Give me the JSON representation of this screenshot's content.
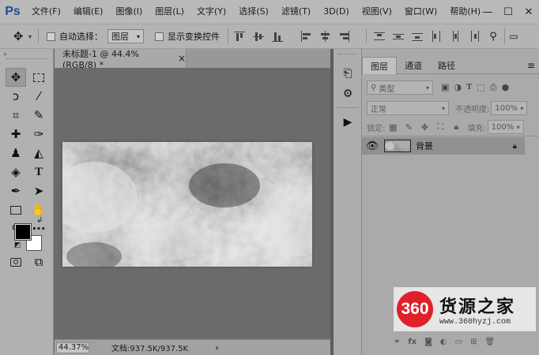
{
  "menubar": {
    "app_logo": "Ps",
    "items": [
      "文件(F)",
      "编辑(E)",
      "图像(I)",
      "图层(L)",
      "文字(Y)",
      "选择(S)",
      "滤镜(T)",
      "3D(D)",
      "视图(V)",
      "窗口(W)",
      "帮助(H)"
    ],
    "minimize": "—",
    "maximize": "☐",
    "close": "✕"
  },
  "options": {
    "auto_select_label": "自动选择：",
    "auto_select_value": "图层",
    "show_transform_label": "显示变换控件"
  },
  "document": {
    "tab_title": "未标题-1 @ 44.4%(RGB/8) *",
    "close": "×",
    "zoom": "44.37%",
    "doc_info": "文档:937.5K/937.5K",
    "status_arrow": "›"
  },
  "layers_panel": {
    "tabs": [
      "图层",
      "通道",
      "路径"
    ],
    "active_tab": "图层",
    "filter_placeholder": "类型",
    "blend_mode": "正常",
    "opacity_label": "不透明度:",
    "opacity_value": "100%",
    "lock_label": "锁定:",
    "fill_label": "填充:",
    "fill_value": "100%",
    "layers": [
      {
        "name": "背景",
        "visible": true,
        "locked": true
      }
    ]
  },
  "watermark": {
    "logo_text": "360",
    "name": "货源之家",
    "url": "www.360hyzj.com"
  },
  "colors": {
    "foreground": "#000000",
    "background": "#ffffff",
    "logo_blue": "#1e4a9c",
    "watermark_red": "#e0202a"
  }
}
